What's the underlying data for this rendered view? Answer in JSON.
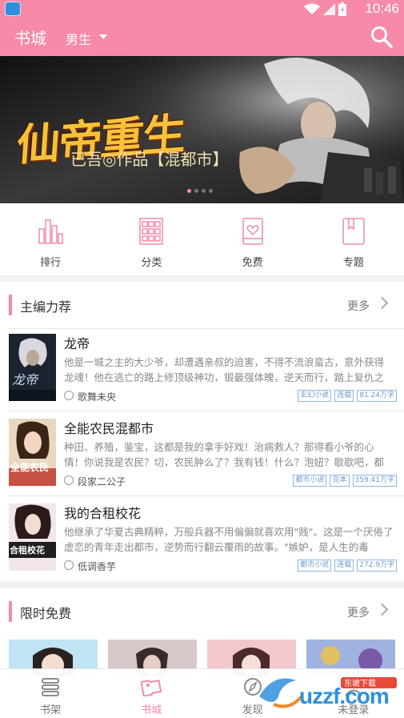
{
  "status_bar": {
    "time": "10:46",
    "app_icon_text": ""
  },
  "header": {
    "title": "书城",
    "gender_filter": "男生"
  },
  "banner": {
    "title": "仙帝重生",
    "subtitle": "已吾◎作品【混都市】",
    "page_count": 4,
    "active_page": 1
  },
  "quick_nav": [
    {
      "label": "排行",
      "icon": "ranking-icon"
    },
    {
      "label": "分类",
      "icon": "category-icon"
    },
    {
      "label": "免费",
      "icon": "free-book-icon"
    },
    {
      "label": "专题",
      "icon": "topic-icon"
    }
  ],
  "editor_picks": {
    "title": "主编力荐",
    "more_label": "更多",
    "books": [
      {
        "title": "龙帝",
        "description": "他是一城之主的大少爷，却遭遇亲叔的迫害，不得不流浪蛮古，意外获得龙魂！他在逃亡的路上修顶级神功，锻最强体魄，逆天而行，踏上复仇之",
        "author": "歌舞未央",
        "cover_text": "龙帝",
        "tags": [
          "玄幻小说",
          "连载",
          "81.24万字"
        ]
      },
      {
        "title": "全能农民混都市",
        "description": "种田、养殖，鉴宝，这都是我的拿手好戏！治病救人？那得看小爷的心情！你说我是农民？切，农民肿么了？我有钱！什么？泡妞？歇歇吧，都",
        "author": "段家二公子",
        "cover_text": "全能农民",
        "tags": [
          "都市小说",
          "完本",
          "359.41万字"
        ]
      },
      {
        "title": "我的合租校花",
        "description": "他继承了华夏古典精粹，万般兵器不用偏偏就喜欢用\"贱\"。这是一个厌倦了虚恋的青年走出都市，逆势而行翻云覆雨的故事。\"嫉妒，是人生的毒",
        "author": "低调香芋",
        "cover_text": "合租校花",
        "tags": [
          "都市小说",
          "连载",
          "272.9万字"
        ]
      }
    ]
  },
  "limited_free": {
    "title": "限时免费",
    "more_label": "更多"
  },
  "bottom_nav": [
    {
      "label": "书架",
      "icon": "bookshelf-icon",
      "active": false
    },
    {
      "label": "书城",
      "icon": "bookstore-icon",
      "active": true
    },
    {
      "label": "发现",
      "icon": "discover-icon",
      "active": false
    },
    {
      "label": "未登录",
      "icon": "profile-icon",
      "active": false
    }
  ],
  "watermark": {
    "text": "uzzf.com",
    "badge": "东坡下载"
  },
  "colors": {
    "accent": "#f68aa8",
    "tag_blue": "#6a9bd0"
  }
}
